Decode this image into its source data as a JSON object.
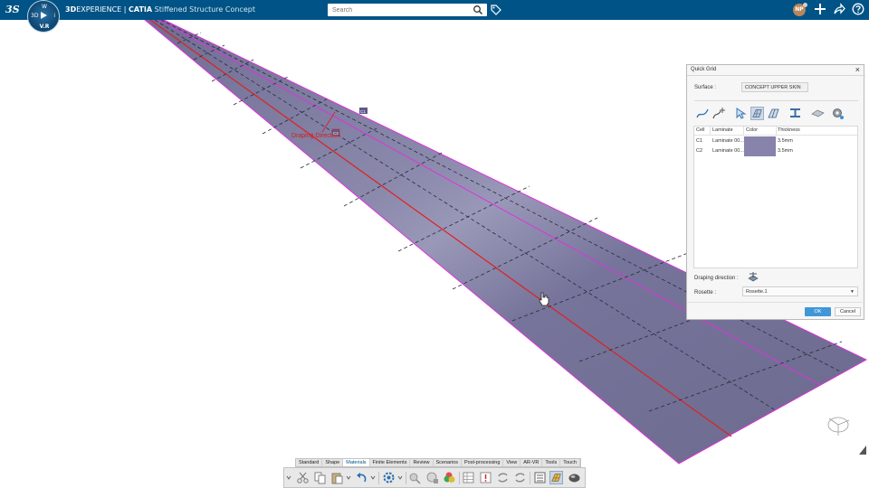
{
  "topbar": {
    "logo_text": "3S",
    "compass_left": "3D",
    "compass_right": "i",
    "compass_top": "W",
    "compass_version": "V.R",
    "brand_bold": "3D",
    "brand_rest": "EXPERIENCE",
    "app_name": "CATIA",
    "app_separator": " | ",
    "app_module": "Stiffened Structure Concept",
    "search_placeholder": "Search",
    "user_initials": "NP"
  },
  "viewport": {
    "cell_label_c1": "C1",
    "cell_label_c2": "C2",
    "draping_tag": "Draping Direction"
  },
  "dialog": {
    "title": "Quick Grid",
    "close": "×",
    "surface_label": "Surface :",
    "surface_value": "CONCEPT UPPER SKIN",
    "table": {
      "headers": [
        "Cell",
        "Laminate",
        "Color",
        "Thickness"
      ],
      "rows": [
        {
          "cell": "C1",
          "laminate": "Laminate 00...",
          "color": "#8783aa",
          "thickness": "3.5mm"
        },
        {
          "cell": "C2",
          "laminate": "Laminate 00...",
          "color": "#8783aa",
          "thickness": "3.5mm"
        }
      ]
    },
    "draping_label": "Draping direction :",
    "rosette_label": "Rosette :",
    "rosette_value": "Rosette.1",
    "ok_label": "OK",
    "cancel_label": "Cancel"
  },
  "action_bar": {
    "tabs": [
      "Standard",
      "Shape",
      "Materials",
      "Finite Elements",
      "Review",
      "Scenarios",
      "Post-processing",
      "View",
      "AR-VR",
      "Tools",
      "Touch"
    ],
    "active_tab": "Materials"
  },
  "colors": {
    "topbar": "#005386",
    "surface_fill": "#7a7a9b",
    "edge_magenta": "#dd33dd",
    "centerline_red": "#e02020"
  }
}
